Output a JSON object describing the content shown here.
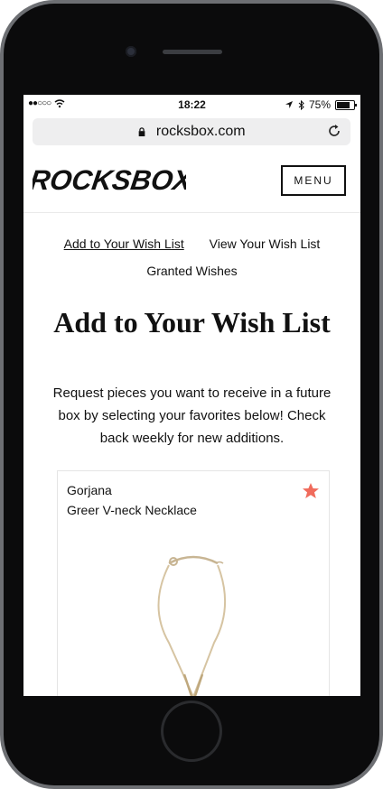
{
  "status_bar": {
    "signal": "●●○○○",
    "time": "18:22",
    "battery": "75%"
  },
  "browser": {
    "url": "rocksbox.com"
  },
  "header": {
    "logo_text": "ROCKSBOX",
    "menu_label": "MENU"
  },
  "nav": {
    "items": [
      {
        "label": "Add to Your Wish List"
      },
      {
        "label": "View Your Wish List"
      },
      {
        "label": "Granted Wishes"
      }
    ]
  },
  "page": {
    "title": "Add to Your Wish List",
    "description": "Request pieces you want to receive in a future box by selecting your favorites below! Check back weekly for new additions."
  },
  "product": {
    "brand": "Gorjana",
    "name": "Greer V-neck Necklace",
    "favorite_icon": "star-icon",
    "favorite_color": "#f06b5c"
  }
}
